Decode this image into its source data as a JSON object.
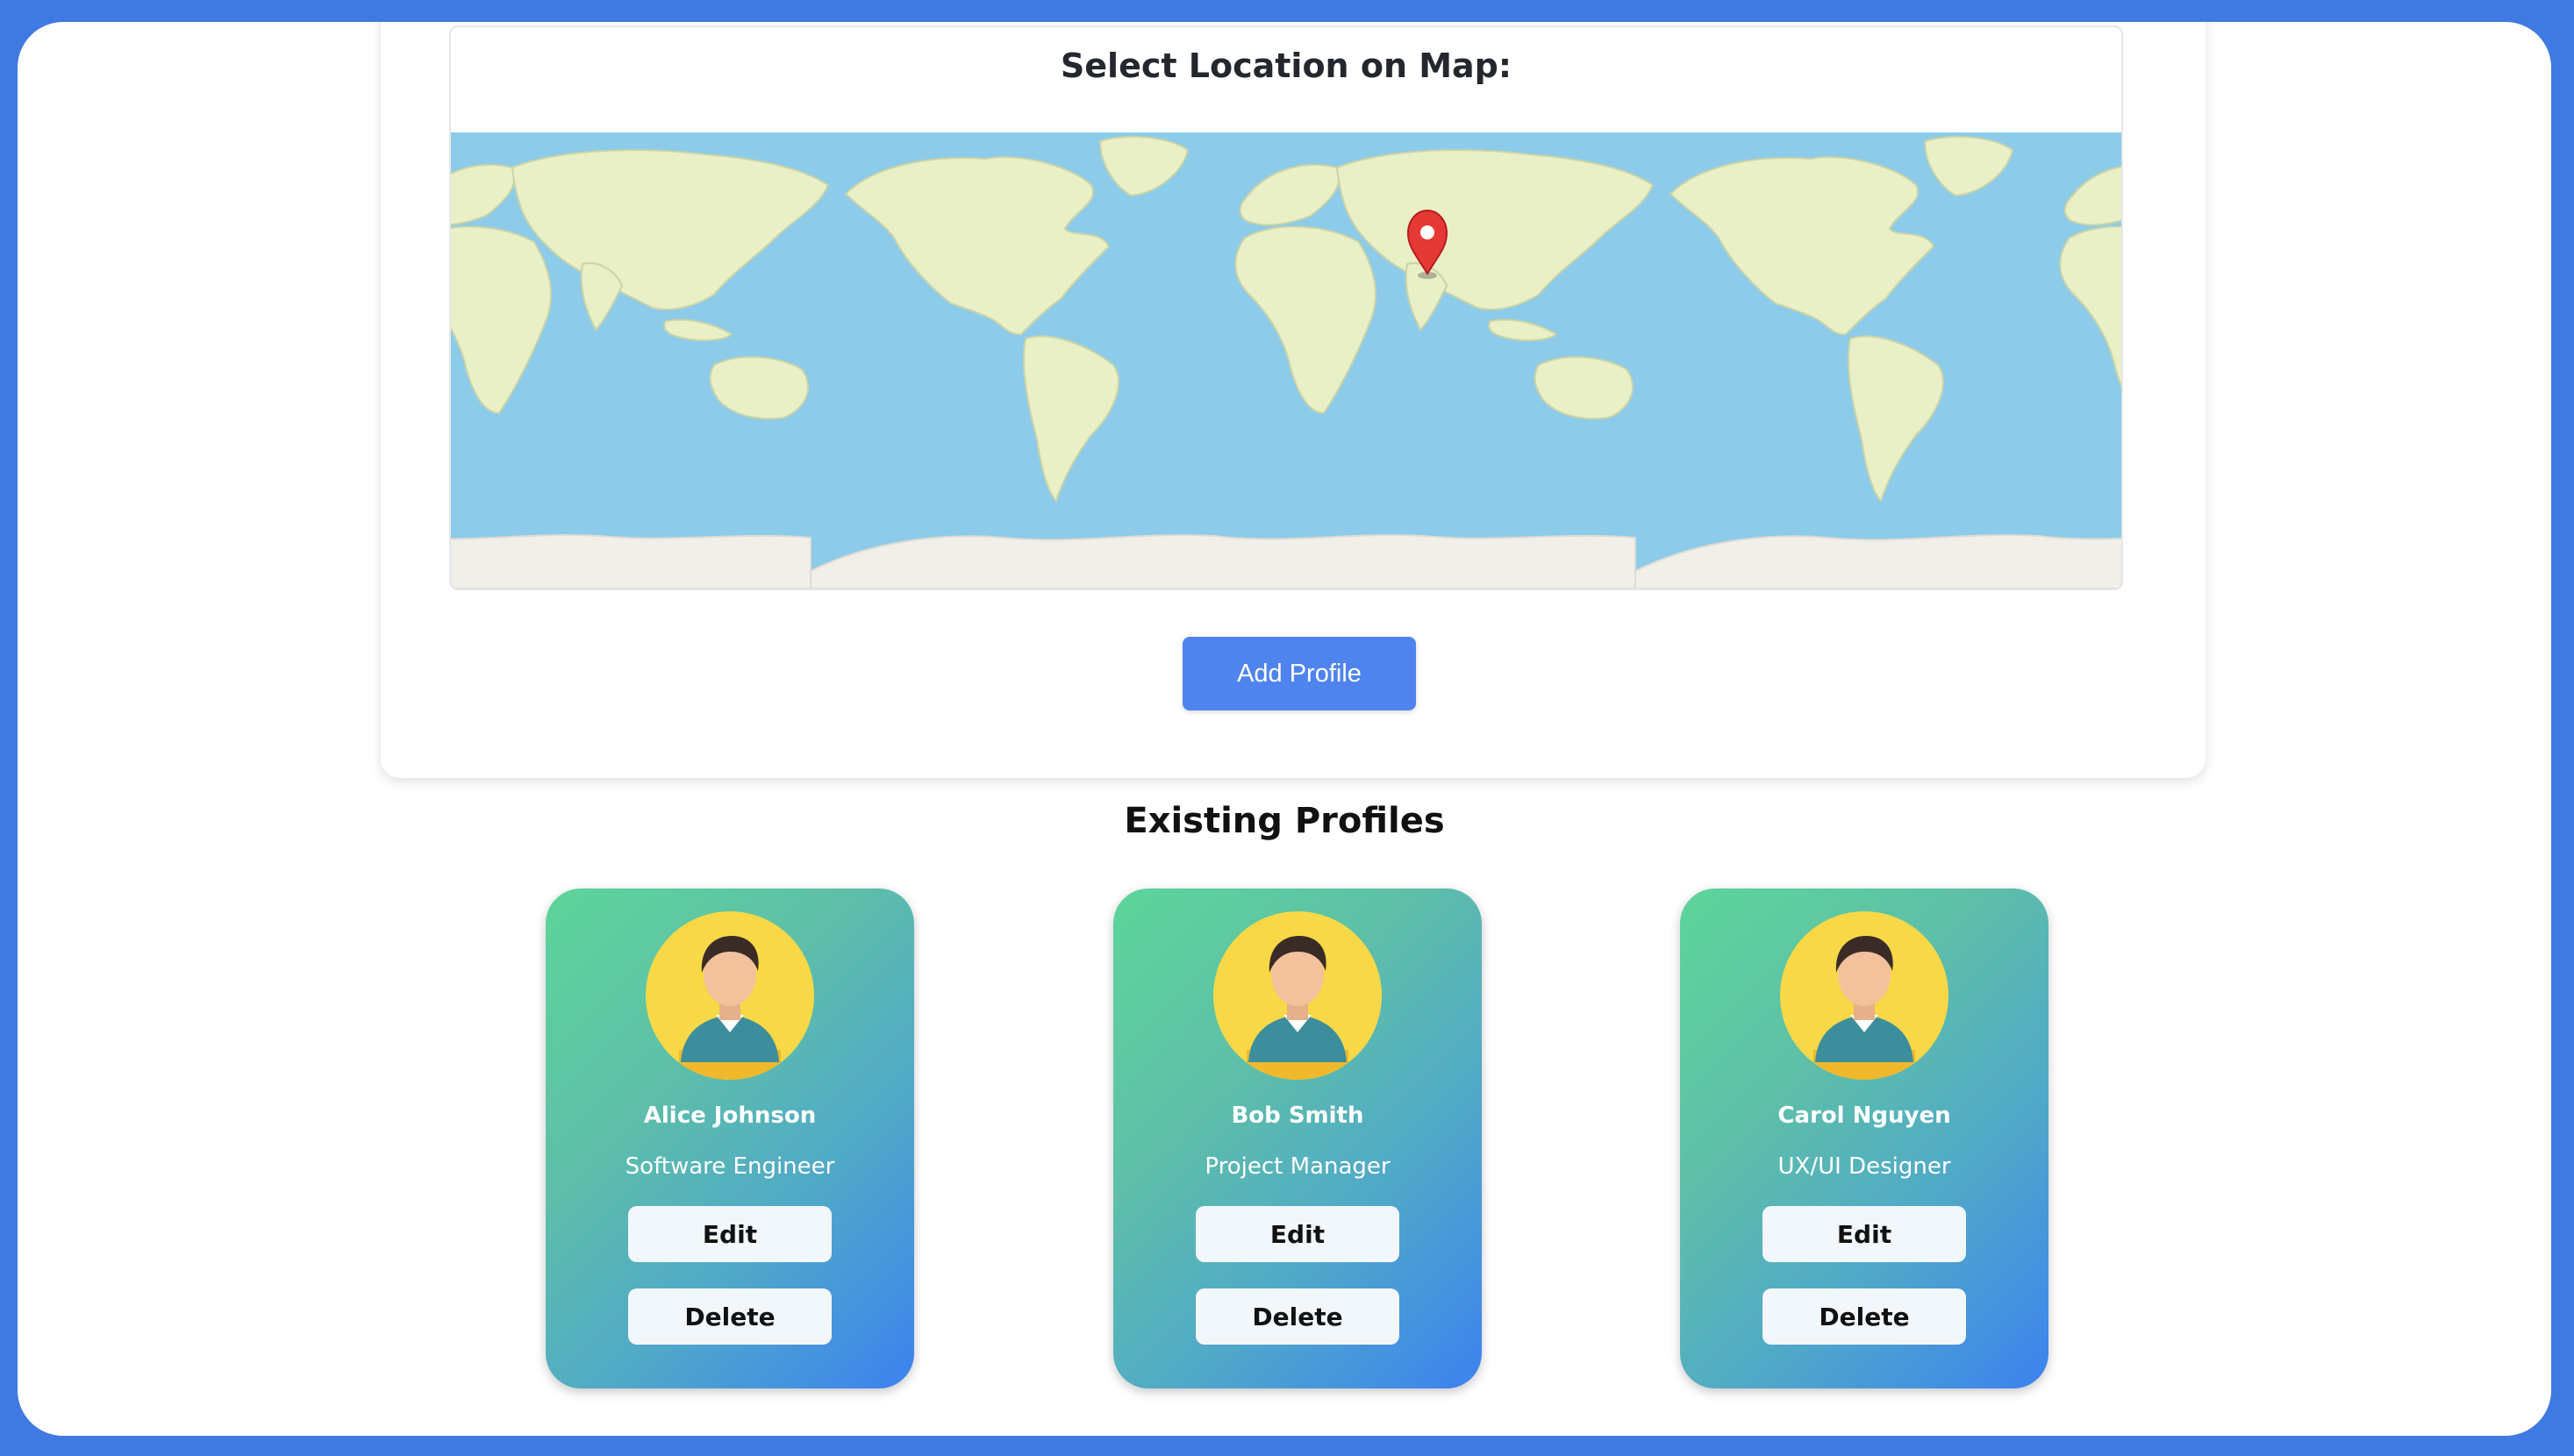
{
  "map": {
    "title": "Select Location on Map:",
    "marker_icon": "location-pin-icon",
    "marker_color": "#e53935",
    "ocean_color": "#8ccbea",
    "land_color": "#e9efc6"
  },
  "form": {
    "add_button_label": "Add Profile",
    "accent": "#4f84ee"
  },
  "profiles_section": {
    "title": "Existing Profiles",
    "profiles": [
      {
        "name": "Alice Johnson",
        "role": "Software Engineer",
        "edit_label": "Edit",
        "delete_label": "Delete"
      },
      {
        "name": "Bob Smith",
        "role": "Project Manager",
        "edit_label": "Edit",
        "delete_label": "Delete"
      },
      {
        "name": "Carol Nguyen",
        "role": "UX/UI Designer",
        "edit_label": "Edit",
        "delete_label": "Delete"
      }
    ]
  }
}
